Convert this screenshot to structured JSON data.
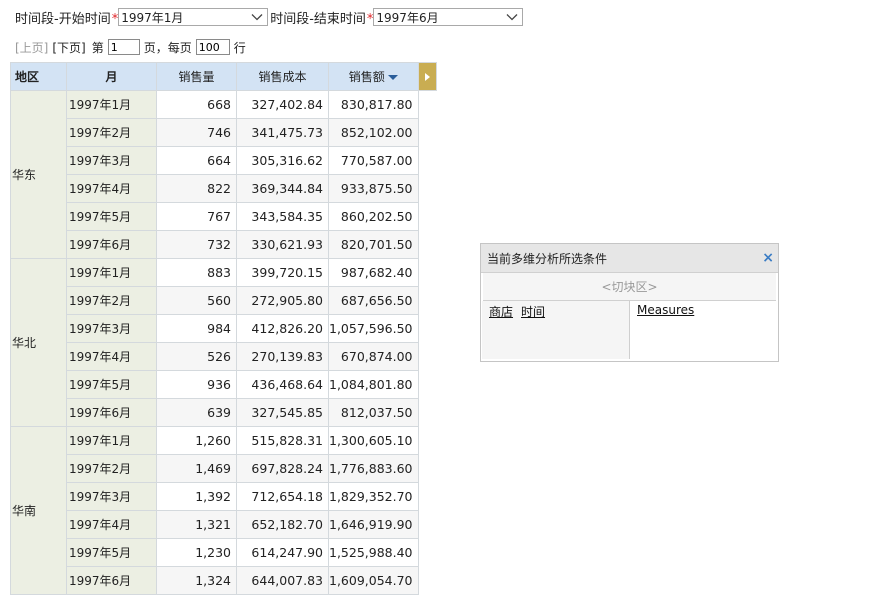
{
  "filters": {
    "start_label": "时间段-开始时间",
    "start_required": "*",
    "start_value": "1997年1月",
    "end_label": "时间段-结束时间",
    "end_required": "*",
    "end_value": "1997年6月"
  },
  "pager": {
    "prev": "[上页]",
    "next": "[下页]",
    "page_prefix": "第",
    "page_value": "1",
    "page_suffix": "页，每页",
    "per_page_value": "100",
    "per_page_suffix": "行"
  },
  "table": {
    "headers": {
      "region": "地区",
      "month": "月",
      "qty": "销售量",
      "cost": "销售成本",
      "amount": "销售额"
    },
    "sort_icon": "sort-desc-icon",
    "expand_icon": "expand-right-icon",
    "groups": [
      {
        "region": "华东",
        "rows": [
          {
            "month": "1997年1月",
            "qty": "668",
            "cost": "327,402.84",
            "amount": "830,817.80"
          },
          {
            "month": "1997年2月",
            "qty": "746",
            "cost": "341,475.73",
            "amount": "852,102.00"
          },
          {
            "month": "1997年3月",
            "qty": "664",
            "cost": "305,316.62",
            "amount": "770,587.00"
          },
          {
            "month": "1997年4月",
            "qty": "822",
            "cost": "369,344.84",
            "amount": "933,875.50"
          },
          {
            "month": "1997年5月",
            "qty": "767",
            "cost": "343,584.35",
            "amount": "860,202.50"
          },
          {
            "month": "1997年6月",
            "qty": "732",
            "cost": "330,621.93",
            "amount": "820,701.50"
          }
        ]
      },
      {
        "region": "华北",
        "rows": [
          {
            "month": "1997年1月",
            "qty": "883",
            "cost": "399,720.15",
            "amount": "987,682.40"
          },
          {
            "month": "1997年2月",
            "qty": "560",
            "cost": "272,905.80",
            "amount": "687,656.50"
          },
          {
            "month": "1997年3月",
            "qty": "984",
            "cost": "412,826.20",
            "amount": "1,057,596.50"
          },
          {
            "month": "1997年4月",
            "qty": "526",
            "cost": "270,139.83",
            "amount": "670,874.00"
          },
          {
            "month": "1997年5月",
            "qty": "936",
            "cost": "436,468.64",
            "amount": "1,084,801.80"
          },
          {
            "month": "1997年6月",
            "qty": "639",
            "cost": "327,545.85",
            "amount": "812,037.50"
          }
        ]
      },
      {
        "region": "华南",
        "rows": [
          {
            "month": "1997年1月",
            "qty": "1,260",
            "cost": "515,828.31",
            "amount": "1,300,605.10"
          },
          {
            "month": "1997年2月",
            "qty": "1,469",
            "cost": "697,828.24",
            "amount": "1,776,883.60"
          },
          {
            "month": "1997年3月",
            "qty": "1,392",
            "cost": "712,654.18",
            "amount": "1,829,352.70"
          },
          {
            "month": "1997年4月",
            "qty": "1,321",
            "cost": "652,182.70",
            "amount": "1,646,919.90"
          },
          {
            "month": "1997年5月",
            "qty": "1,230",
            "cost": "614,247.90",
            "amount": "1,525,988.40"
          },
          {
            "month": "1997年6月",
            "qty": "1,324",
            "cost": "644,007.83",
            "amount": "1,609,054.70"
          }
        ]
      }
    ]
  },
  "panel": {
    "title": "当前多维分析所选条件",
    "close_icon": "close-icon",
    "slice_area": "<切块区>",
    "left_links": [
      "商店",
      "时间"
    ],
    "right_links": [
      "Measures"
    ]
  }
}
